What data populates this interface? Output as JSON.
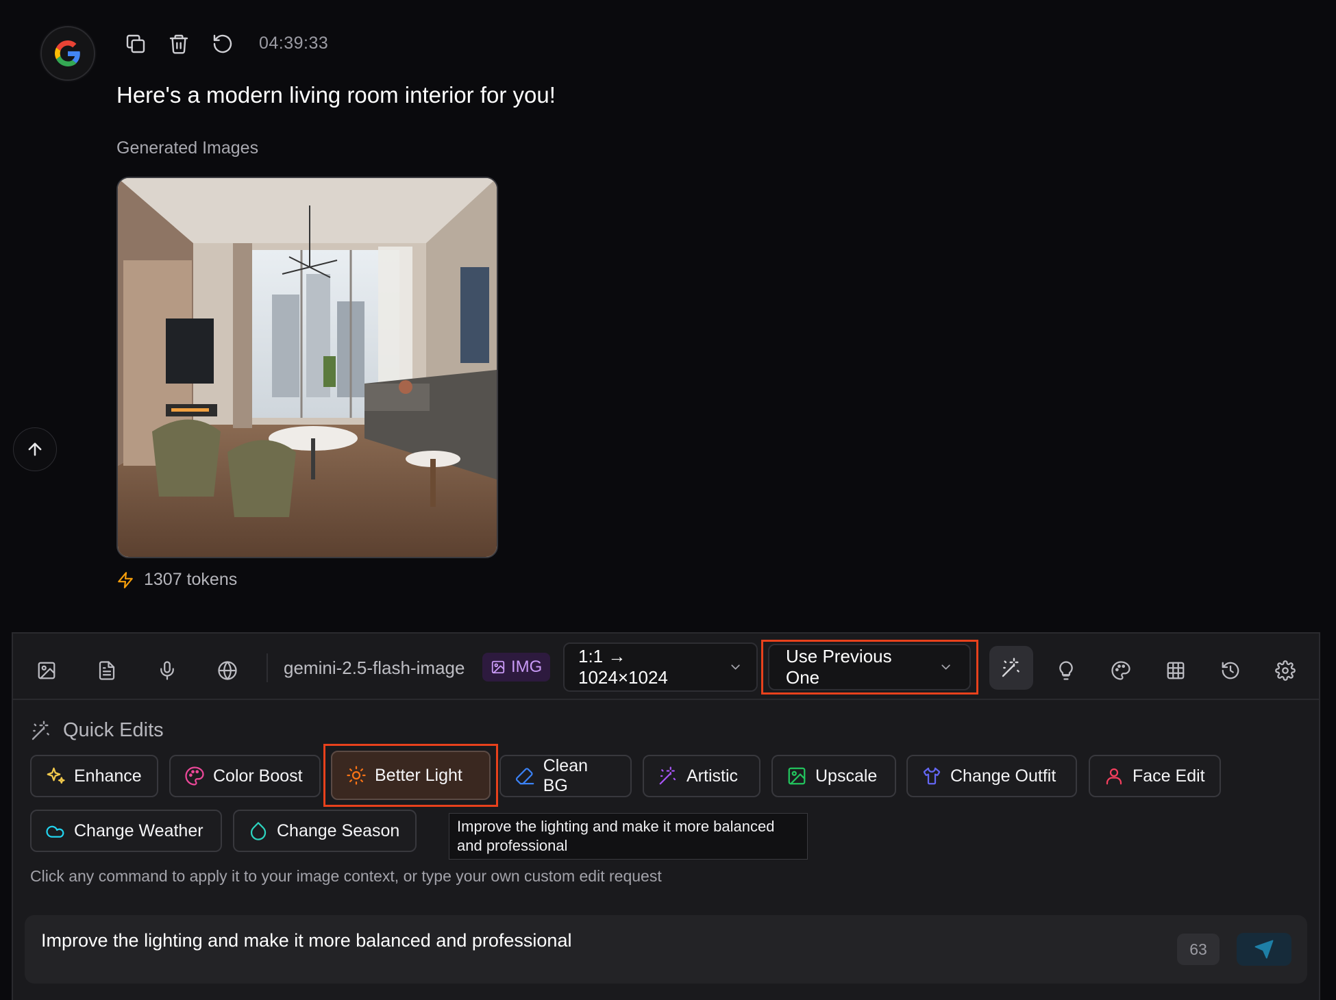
{
  "message": {
    "avatar_icon": "google-g-icon",
    "actions": [
      "copy-icon",
      "trash-icon",
      "rotate-ccw-icon"
    ],
    "timestamp": "04:39:33",
    "text": "Here's a modern living room interior for you!",
    "generated_label": "Generated Images",
    "tokens": "1307 tokens"
  },
  "toolbar": {
    "icons": [
      "image-icon",
      "file-text-icon",
      "mic-icon",
      "globe-icon"
    ],
    "model": "gemini-2.5-flash-image",
    "img_badge": "IMG",
    "aspect_ratio": "1:1 → 1024×1024",
    "context_mode": "Use Previous One",
    "right_icons": [
      "magic-wand-icon",
      "lightbulb-icon",
      "palette-icon",
      "grid-icon",
      "history-icon",
      "settings-icon"
    ]
  },
  "quick_edits": {
    "title": "Quick Edits",
    "commands": [
      {
        "label": "Enhance",
        "icon": "sparkles-icon",
        "color": "#f2c94c"
      },
      {
        "label": "Color Boost",
        "icon": "palette-icon",
        "color": "#ec4899"
      },
      {
        "label": "Better Light",
        "icon": "sun-icon",
        "color": "#f97316",
        "active": true
      },
      {
        "label": "Clean BG",
        "icon": "eraser-icon",
        "color": "#3b82f6"
      },
      {
        "label": "Artistic",
        "icon": "wand-icon",
        "color": "#a855f7"
      },
      {
        "label": "Upscale",
        "icon": "image-icon",
        "color": "#22c55e"
      },
      {
        "label": "Change Outfit",
        "icon": "shirt-icon",
        "color": "#6366f1"
      },
      {
        "label": "Face Edit",
        "icon": "user-icon",
        "color": "#f43f5e"
      },
      {
        "label": "Change Weather",
        "icon": "cloud-icon",
        "color": "#22d3ee"
      },
      {
        "label": "Change Season",
        "icon": "droplet-icon",
        "color": "#2dd4bf"
      }
    ],
    "tooltip": "Improve the lighting and make it more balanced and professional",
    "hint": "Click any command to apply it to your image context, or type your own custom edit request"
  },
  "input": {
    "value": "Improve the lighting and make it more balanced and professional",
    "char_count": "63",
    "send_icon": "send-icon"
  }
}
